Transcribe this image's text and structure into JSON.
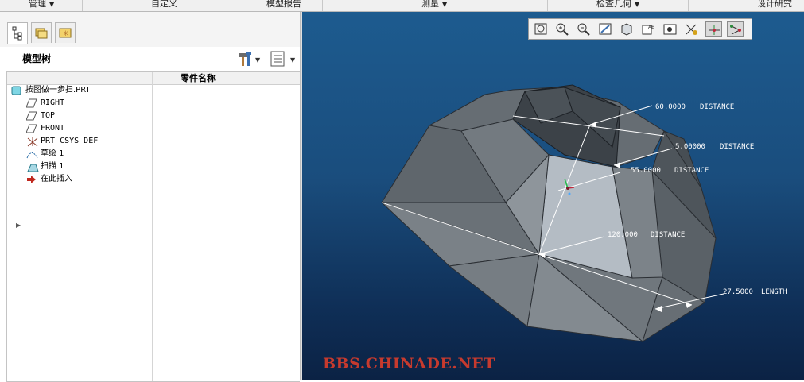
{
  "top_groups": [
    {
      "label": "管理",
      "arrow": "▼"
    },
    {
      "label": "自定义",
      "arrow": ""
    },
    {
      "label": "模型报告",
      "arrow": ""
    },
    {
      "label": "测量",
      "arrow": "▼"
    },
    {
      "label": "检查几何",
      "arrow": "▼"
    },
    {
      "label": "设计研究",
      "arrow": ""
    }
  ],
  "panel": {
    "title": "模型树",
    "tools_icon": "hammer-icon",
    "show_icon": "list-settings-icon",
    "dropdown": "▼",
    "column_header": "零件名称"
  },
  "tree": [
    {
      "label": "按图做一步扫.PRT",
      "icon": "part-icon"
    },
    {
      "label": "RIGHT",
      "icon": "datum-plane-icon"
    },
    {
      "label": "TOP",
      "icon": "datum-plane-icon"
    },
    {
      "label": "FRONT",
      "icon": "datum-plane-icon"
    },
    {
      "label": "PRT_CSYS_DEF",
      "icon": "coordinate-system-icon"
    },
    {
      "label": "草绘 1",
      "icon": "sketch-icon"
    },
    {
      "label": "扫描 1",
      "icon": "sweep-icon"
    },
    {
      "label": "在此插入",
      "icon": "insert-here-arrow-icon"
    }
  ],
  "tree_expander": "▶",
  "view_toolbar": [
    {
      "name": "refit-icon"
    },
    {
      "name": "zoom-in-icon"
    },
    {
      "name": "zoom-out-icon"
    },
    {
      "name": "repaint-icon"
    },
    {
      "name": "display-style-icon"
    },
    {
      "name": "saved-views-icon"
    },
    {
      "name": "view-manager-icon"
    },
    {
      "name": "datum-display-icon"
    },
    {
      "name": "spin-center-icon"
    },
    {
      "name": "annotation-display-icon"
    }
  ],
  "dimensions": [
    {
      "value": "60.0000",
      "type": "DISTANCE"
    },
    {
      "value": "5.00000",
      "type": "DISTANCE"
    },
    {
      "value": "55.0000",
      "type": "DISTANCE"
    },
    {
      "value": "120.000",
      "type": "DISTANCE"
    },
    {
      "value": "27.5000",
      "type": "LENGTH"
    }
  ],
  "watermark": "BBS.CHINADE.NET",
  "colors": {
    "viewport_top": "#1d5b8f",
    "viewport_bottom": "#0b2244",
    "model_face": "#6e757c",
    "watermark": "#c63a2e"
  }
}
